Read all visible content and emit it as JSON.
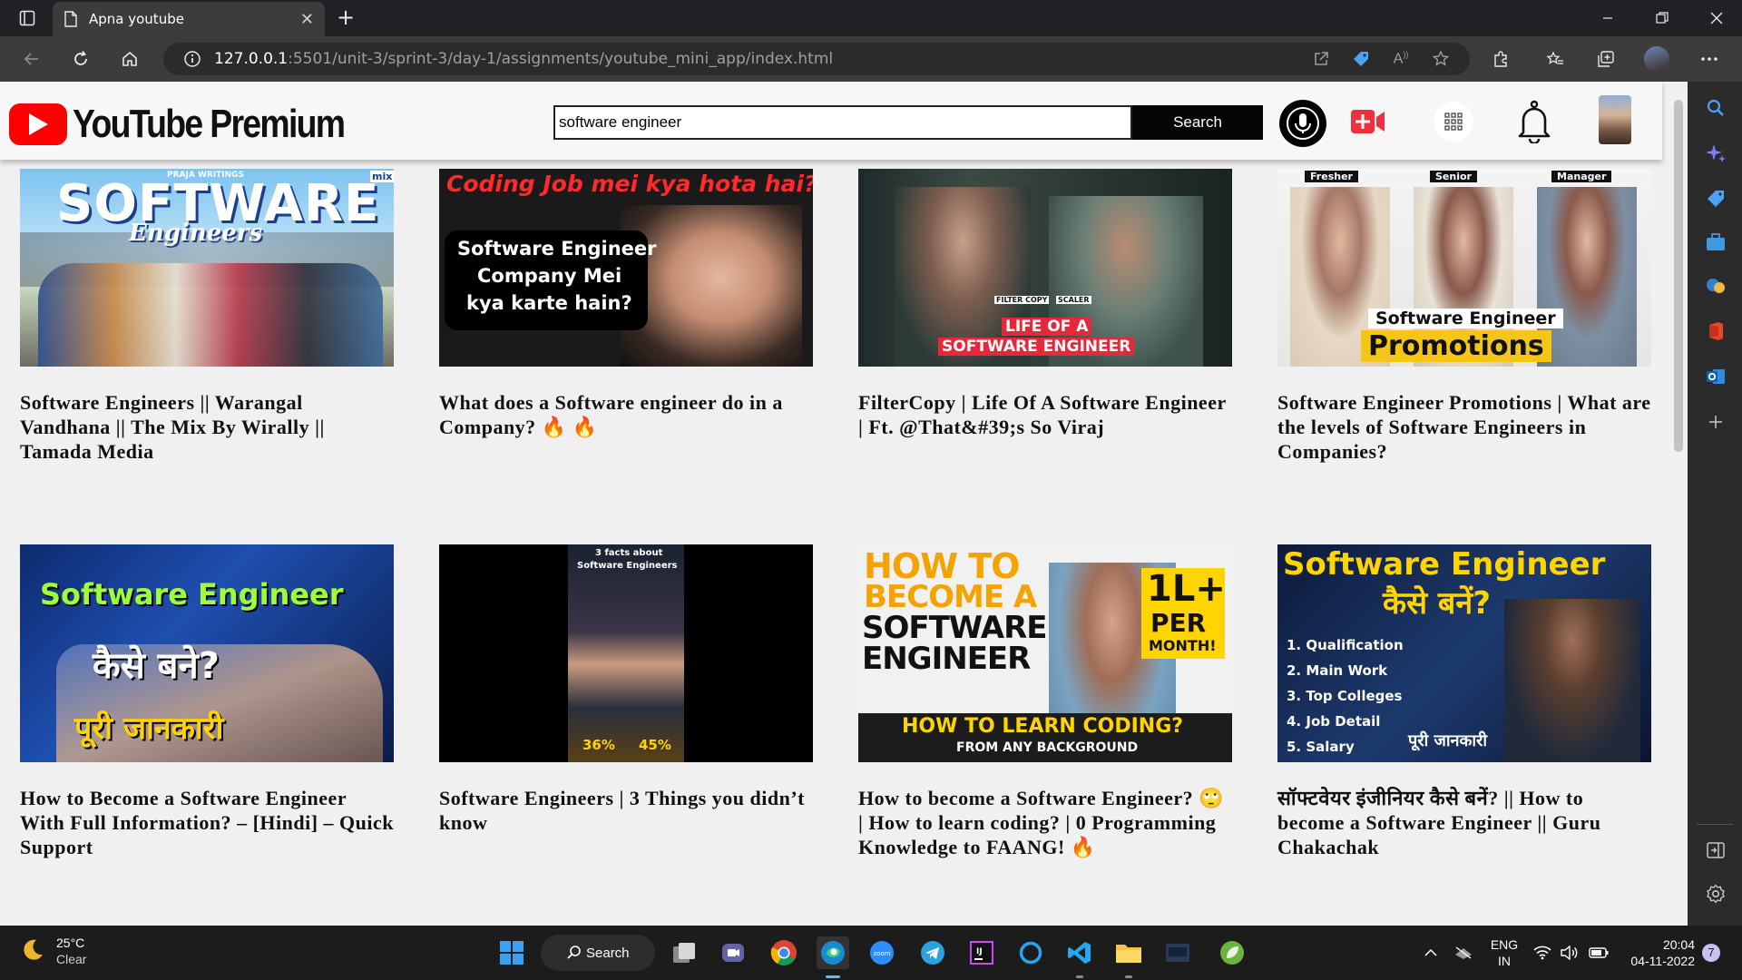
{
  "browser": {
    "tab_title": "Apna youtube",
    "tab_close": "✕",
    "new_tab": "+",
    "url_host": "127.0.0.1",
    "url_path": ":5501/unit-3/sprint-3/day-1/assignments/youtube_mini_app/index.html"
  },
  "header": {
    "logo_text": "YouTube Premium",
    "search_value": "software engineer",
    "search_button": "Search"
  },
  "videos": [
    {
      "title": "Software Engineers || Warangal Vandhana || The Mix By Wirally || Tamada Media",
      "thumb_text_1": "SOFTWARE",
      "thumb_text_2": "Engineers",
      "thumb_text_3": "PRAJA WRITINGS",
      "thumb_text_4": "mix"
    },
    {
      "title": "What does a Software engineer do in a Company? 🔥 🔥",
      "thumb_text_1": "Coding Job mei kya hota hai?",
      "thumb_text_2": "Software Engineer",
      "thumb_text_3": "Company Mei",
      "thumb_text_4": "kya karte hain?"
    },
    {
      "title": "FilterCopy | Life Of A Software Engineer | Ft. @That&#39;s So Viraj",
      "thumb_text_1": "LIFE OF A",
      "thumb_text_2": "SOFTWARE ENGINEER",
      "thumb_text_3": "FILTER COPY",
      "thumb_text_4": "SCALER"
    },
    {
      "title": "Software Engineer Promotions | What are the levels of Software Engineers in Companies?",
      "thumb_text_1": "Fresher",
      "thumb_text_2": "Senior",
      "thumb_text_3": "Manager",
      "thumb_text_4": "Software Engineer",
      "thumb_text_5": "Promotions"
    },
    {
      "title": "How to Become a Software Engineer With Full Information? – [Hindi] – Quick Support",
      "thumb_text_1": "Software Engineer",
      "thumb_text_2": "कैसे बने?",
      "thumb_text_3": "पूरी जानकारी"
    },
    {
      "title": "Software Engineers | 3 Things you didn’t know",
      "thumb_text_1": "3 facts about",
      "thumb_text_2": "Software Engineers",
      "thumb_text_3": "36%",
      "thumb_text_4": "45%"
    },
    {
      "title": "How to become a Software Engineer? 🙄 | How to learn coding? | 0 Programming Knowledge to FAANG! 🔥",
      "thumb_text_1": "HOW TO",
      "thumb_text_2": "BECOME A",
      "thumb_text_3": "SOFTWARE",
      "thumb_text_4": "ENGINEER",
      "thumb_text_5": "1L+",
      "thumb_text_6": "PER",
      "thumb_text_7": "MONTH!",
      "thumb_text_8": "HOW TO LEARN CODING?",
      "thumb_text_9": "FROM ANY BACKGROUND"
    },
    {
      "title": "सॉफ्टवेयर इंजीनियर कैसे बनें? || How to become a Software Engineer || Guru Chakachak",
      "thumb_text_1": "Software Engineer",
      "thumb_text_2": "कैसे बनें?",
      "thumb_text_3": "1. Qualification",
      "thumb_text_4": "2. Main Work",
      "thumb_text_5": "3. Top Colleges",
      "thumb_text_6": "4. Job Detail",
      "thumb_text_7": "5. Salary",
      "thumb_text_8": "पूरी जानकारी"
    }
  ],
  "taskbar": {
    "temp": "25°C",
    "condition": "Clear",
    "search": "Search",
    "lang_1": "ENG",
    "lang_2": "IN",
    "time": "20:04",
    "date": "04-11-2022",
    "notif_count": "7"
  },
  "colors": {
    "youtube_red": "#ff0000",
    "header_bg": "#f7f7f7",
    "page_bg": "#f0f0f0",
    "chrome_dark": "#202124",
    "addressbar": "#3c3c3c"
  }
}
